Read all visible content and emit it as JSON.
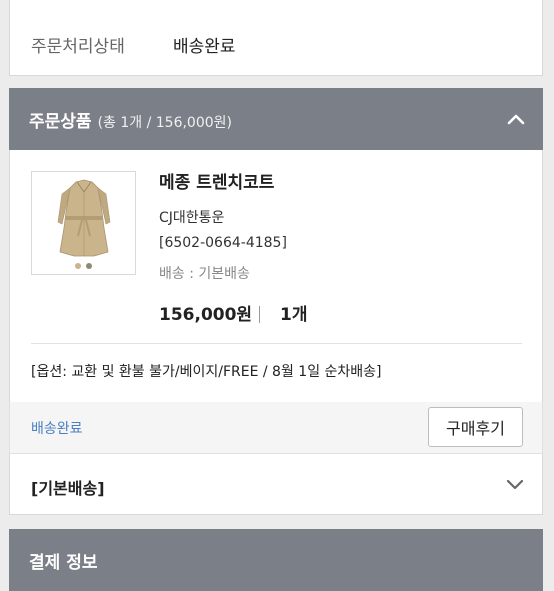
{
  "order_status": {
    "label": "주문처리상태",
    "value": "배송완료"
  },
  "products_header": {
    "title": "주문상품",
    "summary": "(총 1개 / 156,000원)"
  },
  "product": {
    "name": "메종 트렌치코트",
    "carrier": "CJ대한통운",
    "tracking": "[6502-0664-4185]",
    "shipping": "배송 : 기본배송",
    "price": "156,000원",
    "quantity": "1개",
    "option": "[옵션: 교환 및 환불 불가/베이지/FREE / 8월 1일 순차배송]"
  },
  "status_row": {
    "status": "배송완료",
    "review_button": "구매후기"
  },
  "shipping_group": {
    "label": "[기본배송]"
  },
  "payment_header": {
    "title": "결제 정보"
  },
  "colors": {
    "header_bg": "#7b7f88",
    "status_blue": "#4a7fc1",
    "coat": "#c9b48c"
  }
}
